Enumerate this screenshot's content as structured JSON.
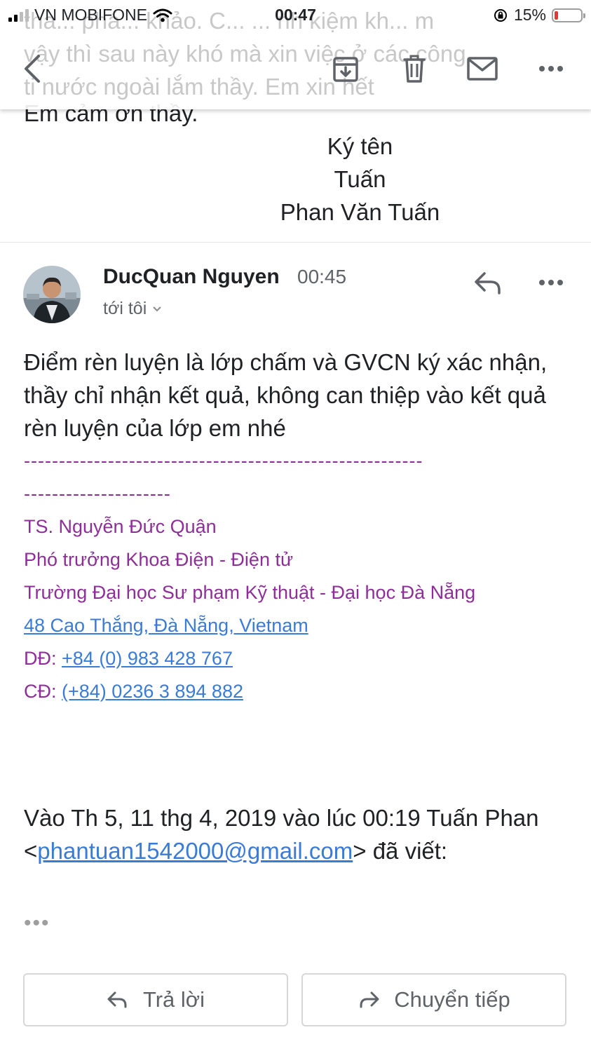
{
  "status_bar": {
    "carrier": "VN MOBIFONE",
    "time": "00:47",
    "battery_percent": "15%",
    "battery_level": 0.15
  },
  "toolbar": {
    "icons": [
      "back-icon",
      "archive-icon",
      "trash-icon",
      "mail-icon",
      "more-icon"
    ],
    "ghost_lines": [
      "tha... phá... khảo. C... ... nh kiệm kh... m",
      "vậy thì sau này khó mà xin việc ở các công",
      "ti nước ngoài lắm thầy. Em xin hết"
    ]
  },
  "previous_message": {
    "closing": "Em cảm ơn thầy.",
    "signature_label": "Ký tên",
    "signature_short": "Tuấn",
    "signature_full": "Phan Văn Tuấn"
  },
  "message": {
    "sender": "DucQuan Nguyen",
    "time": "00:45",
    "recipient": "tới tôi",
    "body": "Điểm rèn luyện là lớp chấm và GVCN ký xác nhận, thầy chỉ nhận kết quả, không can thiệp vào kết quả rèn luyện của lớp em nhé",
    "separator_line1": "---------------------------------------------------------",
    "separator_line2": "---------------------",
    "signature": {
      "name": "TS. Nguyễn Đức Quận",
      "title": "Phó trưởng Khoa Điện - Điện tử",
      "org": "Trường Đại học Sư phạm Kỹ thuật - Đại học Đà Nẵng",
      "address": "48 Cao Thắng, Đà Nẵng, Vietnam",
      "mobile_label": "DĐ:",
      "mobile": "+84 (0) 983 428 767",
      "phone_label": "CĐ:",
      "phone": "(+84) 0236 3 894 882"
    },
    "quote_prefix": "Vào Th 5, 11 thg 4, 2019 vào lúc 00:19 Tuấn Phan <",
    "quote_email": "phantuan1542000@gmail.com",
    "quote_suffix": "> đã viết:",
    "collapsed": "•••"
  },
  "actions": {
    "reply": "Trả lời",
    "forward": "Chuyển tiếp"
  }
}
